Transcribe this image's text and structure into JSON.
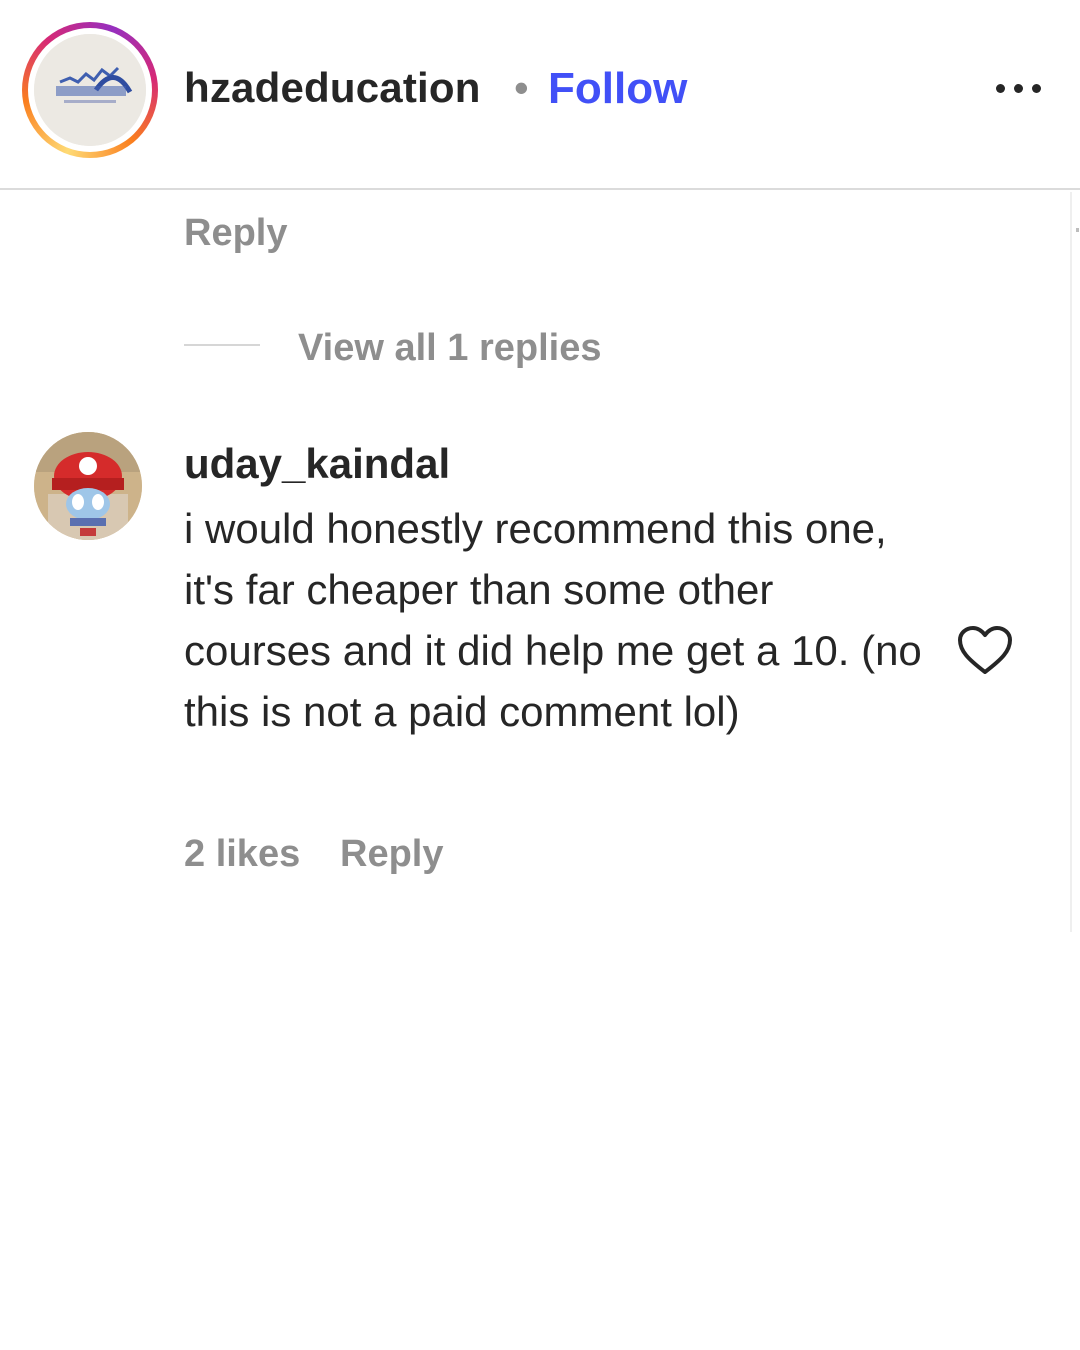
{
  "post_header": {
    "username": "hzadeducation",
    "separator": "•",
    "follow_label": "Follow",
    "more_icon": "more-horizontal-icon"
  },
  "previous_comment": {
    "reply_label": "Reply",
    "view_replies_label": "View all 1 replies"
  },
  "comment": {
    "username": "uday_kaindal",
    "text": "i would honestly recommend this one, it's far cheaper than some other courses and it did help me get a 10. (no this is not a paid comment lol)",
    "likes_label": "2 likes",
    "reply_label": "Reply",
    "like_icon": "heart-outline-icon"
  },
  "colors": {
    "follow_blue": "#4150f7",
    "text_primary": "#262626",
    "text_secondary": "#8e8e8e",
    "divider": "#dbdbdb"
  }
}
